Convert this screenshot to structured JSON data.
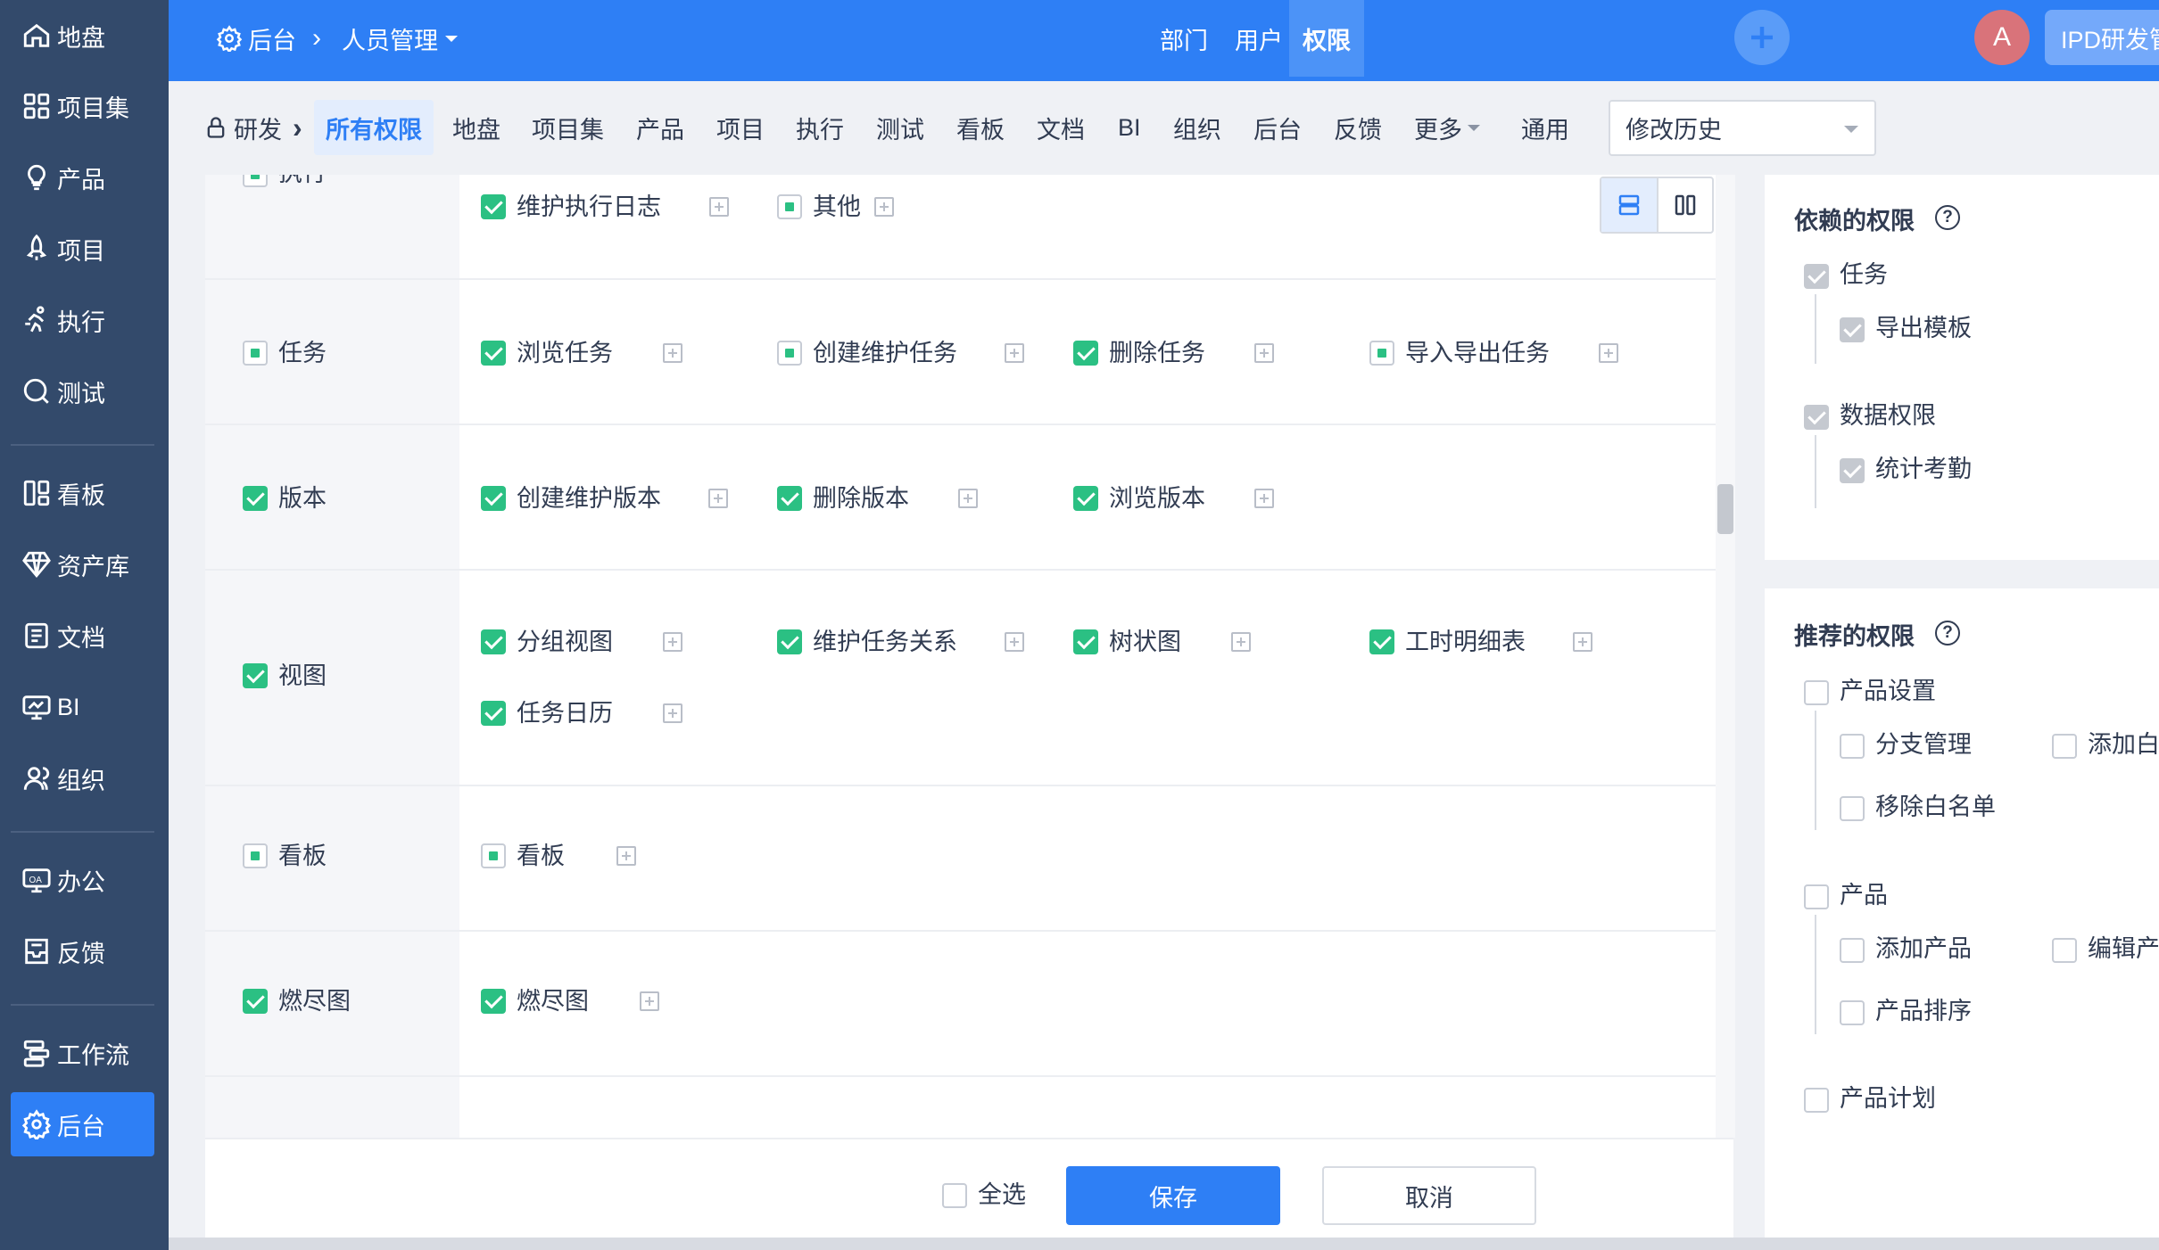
{
  "sidebar": {
    "items": [
      {
        "label": "地盘",
        "icon": "home-icon"
      },
      {
        "label": "项目集",
        "icon": "grid-icon"
      },
      {
        "label": "产品",
        "icon": "lightbulb-icon"
      },
      {
        "label": "项目",
        "icon": "rocket-icon"
      },
      {
        "label": "执行",
        "icon": "run-icon"
      },
      {
        "label": "测试",
        "icon": "search-icon"
      },
      {
        "label": "看板",
        "icon": "kanban-icon"
      },
      {
        "label": "资产库",
        "icon": "diamond-icon"
      },
      {
        "label": "文档",
        "icon": "document-icon"
      },
      {
        "label": "BI",
        "icon": "monitor-icon"
      },
      {
        "label": "组织",
        "icon": "user-icon"
      },
      {
        "label": "办公",
        "icon": "oa-icon"
      },
      {
        "label": "反馈",
        "icon": "inbox-icon"
      },
      {
        "label": "工作流",
        "icon": "workflow-icon"
      },
      {
        "label": "后台",
        "icon": "gear-icon"
      }
    ],
    "active": "后台"
  },
  "header": {
    "crumb_root": "后台",
    "crumb_current": "人员管理",
    "tabs": [
      "部门",
      "用户",
      "权限"
    ],
    "active_tab": "权限",
    "avatar_initial": "A",
    "app_name": "IPD研发管"
  },
  "subnav": {
    "scope_label": "研发",
    "items": [
      "所有权限",
      "地盘",
      "项目集",
      "产品",
      "项目",
      "执行",
      "测试",
      "看板",
      "文档",
      "BI",
      "组织",
      "后台",
      "反馈",
      "更多",
      "通用"
    ],
    "active": "所有权限",
    "history_select": "修改历史"
  },
  "permissions": {
    "partial_top_label": "执行",
    "rows": [
      {
        "label": "",
        "state": "partial",
        "items": [
          {
            "label": "维护执行日志",
            "state": "checked"
          },
          {
            "label": "其他",
            "state": "partial"
          }
        ]
      },
      {
        "label": "任务",
        "state": "partial",
        "items": [
          {
            "label": "浏览任务",
            "state": "checked"
          },
          {
            "label": "创建维护任务",
            "state": "partial"
          },
          {
            "label": "删除任务",
            "state": "checked"
          },
          {
            "label": "导入导出任务",
            "state": "partial"
          }
        ]
      },
      {
        "label": "版本",
        "state": "checked",
        "items": [
          {
            "label": "创建维护版本",
            "state": "checked"
          },
          {
            "label": "删除版本",
            "state": "checked"
          },
          {
            "label": "浏览版本",
            "state": "checked"
          }
        ]
      },
      {
        "label": "视图",
        "state": "checked",
        "items": [
          {
            "label": "分组视图",
            "state": "checked"
          },
          {
            "label": "维护任务关系",
            "state": "checked"
          },
          {
            "label": "树状图",
            "state": "checked"
          },
          {
            "label": "工时明细表",
            "state": "checked"
          },
          {
            "label": "任务日历",
            "state": "checked"
          }
        ]
      },
      {
        "label": "看板",
        "state": "partial",
        "items": [
          {
            "label": "看板",
            "state": "partial"
          }
        ]
      },
      {
        "label": "燃尽图",
        "state": "checked",
        "items": [
          {
            "label": "燃尽图",
            "state": "checked"
          }
        ]
      }
    ]
  },
  "footer": {
    "select_all": "全选",
    "save": "保存",
    "cancel": "取消"
  },
  "dependent": {
    "title": "依赖的权限",
    "groups": [
      {
        "label": "任务",
        "children": [
          "导出模板"
        ]
      },
      {
        "label": "数据权限",
        "children": [
          "统计考勤"
        ]
      }
    ]
  },
  "recommended": {
    "title": "推荐的权限",
    "groups": [
      {
        "label": "产品设置",
        "children": [
          "分支管理",
          "添加白名单",
          "移除白名单"
        ]
      },
      {
        "label": "产品",
        "children": [
          "添加产品",
          "编辑产品",
          "产品排序"
        ]
      },
      {
        "label": "产品计划",
        "children": []
      }
    ]
  },
  "colors": {
    "primary": "#2e7ff5",
    "sidebar": "#334a6b",
    "check_green": "#2bc083"
  }
}
